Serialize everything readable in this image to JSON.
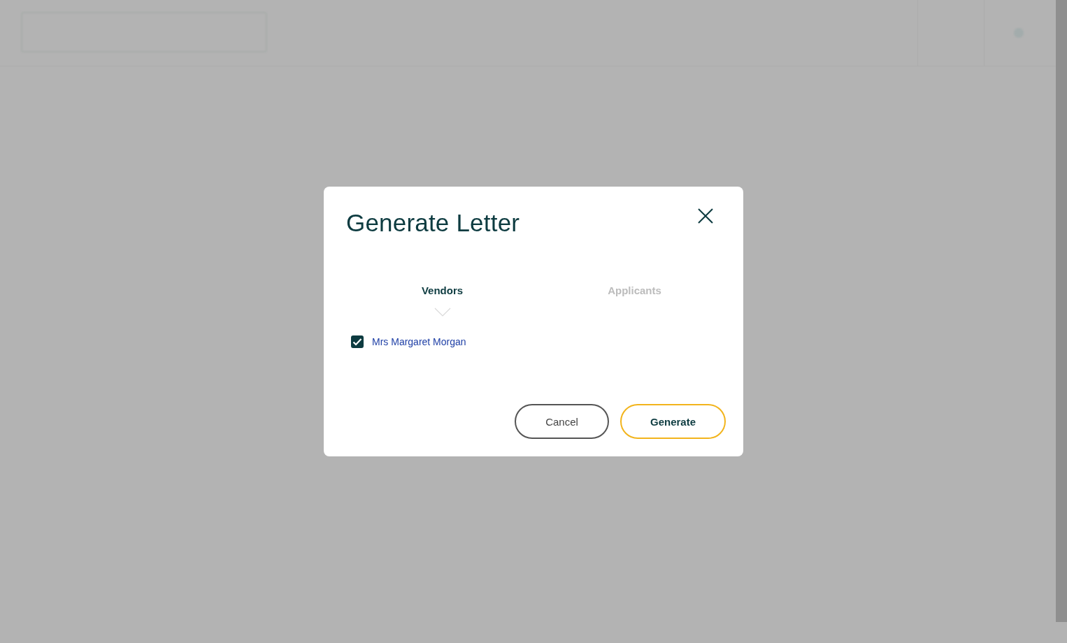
{
  "dialog": {
    "title": "Generate Letter",
    "tabs": [
      {
        "label": "Vendors",
        "selected": true
      },
      {
        "label": "Applicants",
        "selected": false
      }
    ],
    "recipients": [
      {
        "name": "Mrs Margaret Morgan",
        "checked": true
      }
    ],
    "buttons": [
      {
        "label": "Cancel",
        "kind": "secondary"
      },
      {
        "label": "Generate",
        "kind": "primary"
      }
    ]
  }
}
